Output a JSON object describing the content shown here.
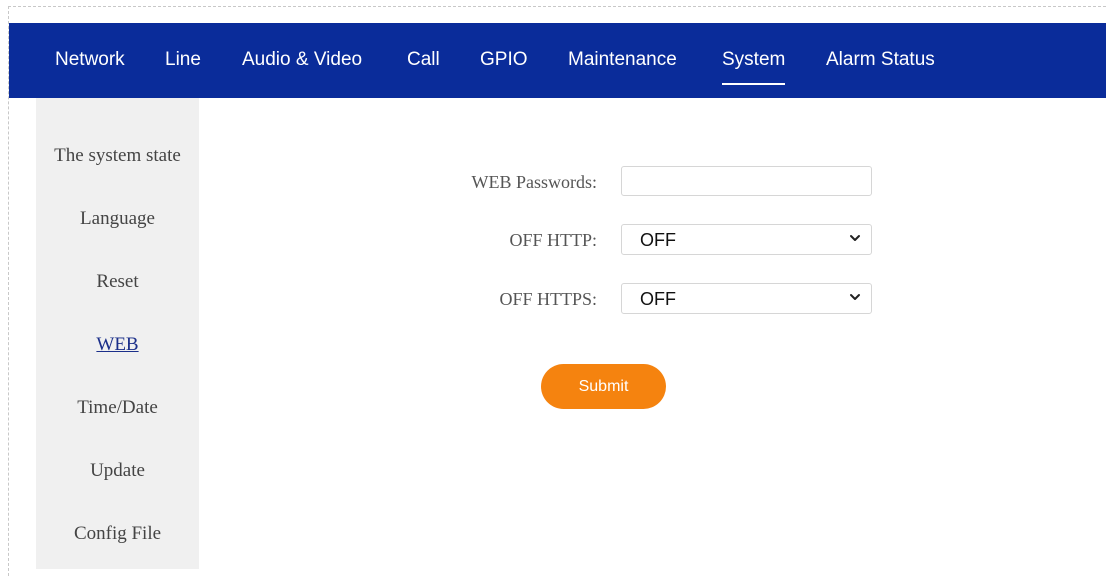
{
  "top_nav": {
    "items": [
      {
        "label": "Network"
      },
      {
        "label": "Line"
      },
      {
        "label": "Audio & Video"
      },
      {
        "label": "Call"
      },
      {
        "label": "GPIO"
      },
      {
        "label": "Maintenance"
      },
      {
        "label": "System",
        "active": true
      },
      {
        "label": "Alarm Status"
      }
    ]
  },
  "sidebar": {
    "items": [
      {
        "label": "The system state"
      },
      {
        "label": "Language"
      },
      {
        "label": "Reset"
      },
      {
        "label": "WEB",
        "active": true
      },
      {
        "label": "Time/Date"
      },
      {
        "label": "Update"
      },
      {
        "label": "Config File"
      }
    ]
  },
  "form": {
    "web_password": {
      "label": "WEB Passwords:",
      "value": ""
    },
    "off_http": {
      "label": "OFF HTTP:",
      "selected": "OFF"
    },
    "off_https": {
      "label": "OFF HTTPS:",
      "selected": "OFF"
    },
    "submit_label": "Submit"
  },
  "colors": {
    "nav_background": "#0a2c9a",
    "sidebar_background": "#f0f0f0",
    "submit_button": "#f5830f",
    "active_sidebar_link": "#1b2f8a"
  },
  "icons": {
    "select_arrow": "chevron-down-icon"
  }
}
